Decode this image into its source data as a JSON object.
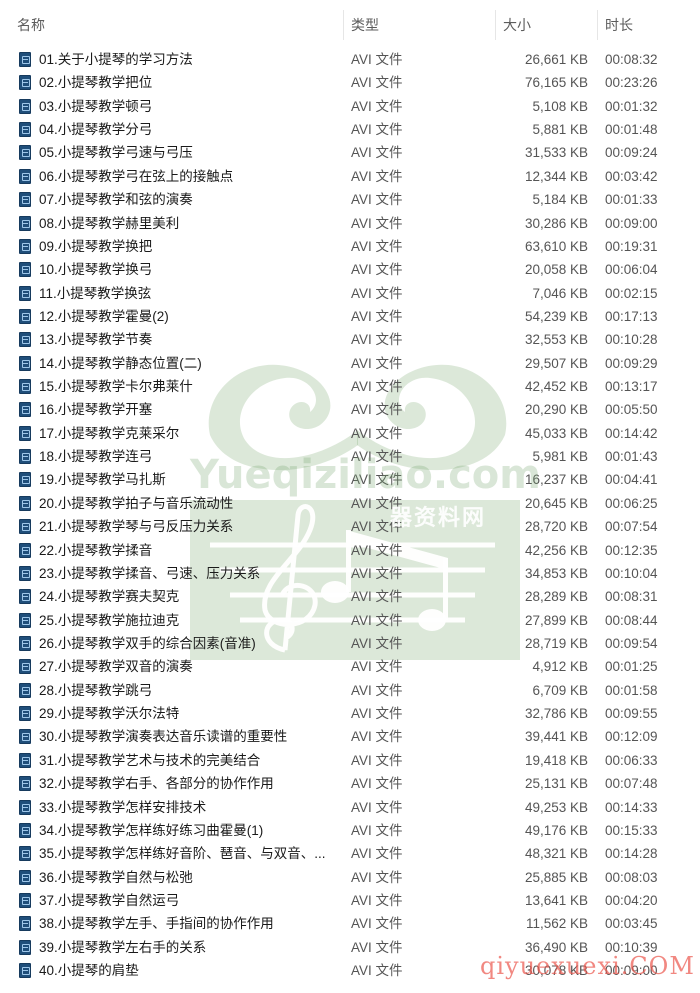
{
  "columns": {
    "name": "名称",
    "type": "类型",
    "size": "大小",
    "duration": "时长"
  },
  "files": [
    {
      "name": "01.关于小提琴的学习方法",
      "type": "AVI 文件",
      "size": "26,661 KB",
      "duration": "00:08:32"
    },
    {
      "name": "02.小提琴教学把位",
      "type": "AVI 文件",
      "size": "76,165 KB",
      "duration": "00:23:26"
    },
    {
      "name": "03.小提琴教学顿弓",
      "type": "AVI 文件",
      "size": "5,108 KB",
      "duration": "00:01:32"
    },
    {
      "name": "04.小提琴教学分弓",
      "type": "AVI 文件",
      "size": "5,881 KB",
      "duration": "00:01:48"
    },
    {
      "name": "05.小提琴教学弓速与弓压",
      "type": "AVI 文件",
      "size": "31,533 KB",
      "duration": "00:09:24"
    },
    {
      "name": "06.小提琴教学弓在弦上的接触点",
      "type": "AVI 文件",
      "size": "12,344 KB",
      "duration": "00:03:42"
    },
    {
      "name": "07.小提琴教学和弦的演奏",
      "type": "AVI 文件",
      "size": "5,184 KB",
      "duration": "00:01:33"
    },
    {
      "name": "08.小提琴教学赫里美利",
      "type": "AVI 文件",
      "size": "30,286 KB",
      "duration": "00:09:00"
    },
    {
      "name": "09.小提琴教学换把",
      "type": "AVI 文件",
      "size": "63,610 KB",
      "duration": "00:19:31"
    },
    {
      "name": "10.小提琴教学换弓",
      "type": "AVI 文件",
      "size": "20,058 KB",
      "duration": "00:06:04"
    },
    {
      "name": "11.小提琴教学换弦",
      "type": "AVI 文件",
      "size": "7,046 KB",
      "duration": "00:02:15"
    },
    {
      "name": "12.小提琴教学霍曼(2)",
      "type": "AVI 文件",
      "size": "54,239 KB",
      "duration": "00:17:13"
    },
    {
      "name": "13.小提琴教学节奏",
      "type": "AVI 文件",
      "size": "32,553 KB",
      "duration": "00:10:28"
    },
    {
      "name": "14.小提琴教学静态位置(二)",
      "type": "AVI 文件",
      "size": "29,507 KB",
      "duration": "00:09:29"
    },
    {
      "name": "15.小提琴教学卡尔弗莱什",
      "type": "AVI 文件",
      "size": "42,452 KB",
      "duration": "00:13:17"
    },
    {
      "name": "16.小提琴教学开塞",
      "type": "AVI 文件",
      "size": "20,290 KB",
      "duration": "00:05:50"
    },
    {
      "name": "17.小提琴教学克莱采尔",
      "type": "AVI 文件",
      "size": "45,033 KB",
      "duration": "00:14:42"
    },
    {
      "name": "18.小提琴教学连弓",
      "type": "AVI 文件",
      "size": "5,981 KB",
      "duration": "00:01:43"
    },
    {
      "name": "19.小提琴教学马扎斯",
      "type": "AVI 文件",
      "size": "16,237 KB",
      "duration": "00:04:41"
    },
    {
      "name": "20.小提琴教学拍子与音乐流动性",
      "type": "AVI 文件",
      "size": "20,645 KB",
      "duration": "00:06:25"
    },
    {
      "name": "21.小提琴教学琴与弓反压力关系",
      "type": "AVI 文件",
      "size": "28,720 KB",
      "duration": "00:07:54"
    },
    {
      "name": "22.小提琴教学揉音",
      "type": "AVI 文件",
      "size": "42,256 KB",
      "duration": "00:12:35"
    },
    {
      "name": "23.小提琴教学揉音、弓速、压力关系",
      "type": "AVI 文件",
      "size": "34,853 KB",
      "duration": "00:10:04"
    },
    {
      "name": "24.小提琴教学赛夫契克",
      "type": "AVI 文件",
      "size": "28,289 KB",
      "duration": "00:08:31"
    },
    {
      "name": "25.小提琴教学施拉迪克",
      "type": "AVI 文件",
      "size": "27,899 KB",
      "duration": "00:08:44"
    },
    {
      "name": "26.小提琴教学双手的综合因素(音准)",
      "type": "AVI 文件",
      "size": "28,719 KB",
      "duration": "00:09:54"
    },
    {
      "name": "27.小提琴教学双音的演奏",
      "type": "AVI 文件",
      "size": "4,912 KB",
      "duration": "00:01:25"
    },
    {
      "name": "28.小提琴教学跳弓",
      "type": "AVI 文件",
      "size": "6,709 KB",
      "duration": "00:01:58"
    },
    {
      "name": "29.小提琴教学沃尔法特",
      "type": "AVI 文件",
      "size": "32,786 KB",
      "duration": "00:09:55"
    },
    {
      "name": "30.小提琴教学演奏表达音乐读谱的重要性",
      "type": "AVI 文件",
      "size": "39,441 KB",
      "duration": "00:12:09"
    },
    {
      "name": "31.小提琴教学艺术与技术的完美结合",
      "type": "AVI 文件",
      "size": "19,418 KB",
      "duration": "00:06:33"
    },
    {
      "name": "32.小提琴教学右手、各部分的协作作用",
      "type": "AVI 文件",
      "size": "25,131 KB",
      "duration": "00:07:48"
    },
    {
      "name": "33.小提琴教学怎样安排技术",
      "type": "AVI 文件",
      "size": "49,253 KB",
      "duration": "00:14:33"
    },
    {
      "name": "34.小提琴教学怎样练好练习曲霍曼(1)",
      "type": "AVI 文件",
      "size": "49,176 KB",
      "duration": "00:15:33"
    },
    {
      "name": "35.小提琴教学怎样练好音阶、琶音、与双音、...",
      "type": "AVI 文件",
      "size": "48,321 KB",
      "duration": "00:14:28"
    },
    {
      "name": "36.小提琴教学自然与松弛",
      "type": "AVI 文件",
      "size": "25,885 KB",
      "duration": "00:08:03"
    },
    {
      "name": "37.小提琴教学自然运弓",
      "type": "AVI 文件",
      "size": "13,641 KB",
      "duration": "00:04:20"
    },
    {
      "name": "38.小提琴教学左手、手指间的协作作用",
      "type": "AVI 文件",
      "size": "11,562 KB",
      "duration": "00:03:45"
    },
    {
      "name": "39.小提琴教学左右手的关系",
      "type": "AVI 文件",
      "size": "36,490 KB",
      "duration": "00:10:39"
    },
    {
      "name": "40.小提琴的肩垫",
      "type": "AVI 文件",
      "size": "30,078 KB",
      "duration": "00:09:00"
    }
  ],
  "watermarks": {
    "center_text": "Yueqiziliao.com",
    "center_cn": "器资料网",
    "bottom_text": "qiyuexuexi.COM",
    "center_color": "#78a56e",
    "bottom_color": "#ec5a50"
  },
  "icons": {
    "file": "video-file-icon"
  }
}
